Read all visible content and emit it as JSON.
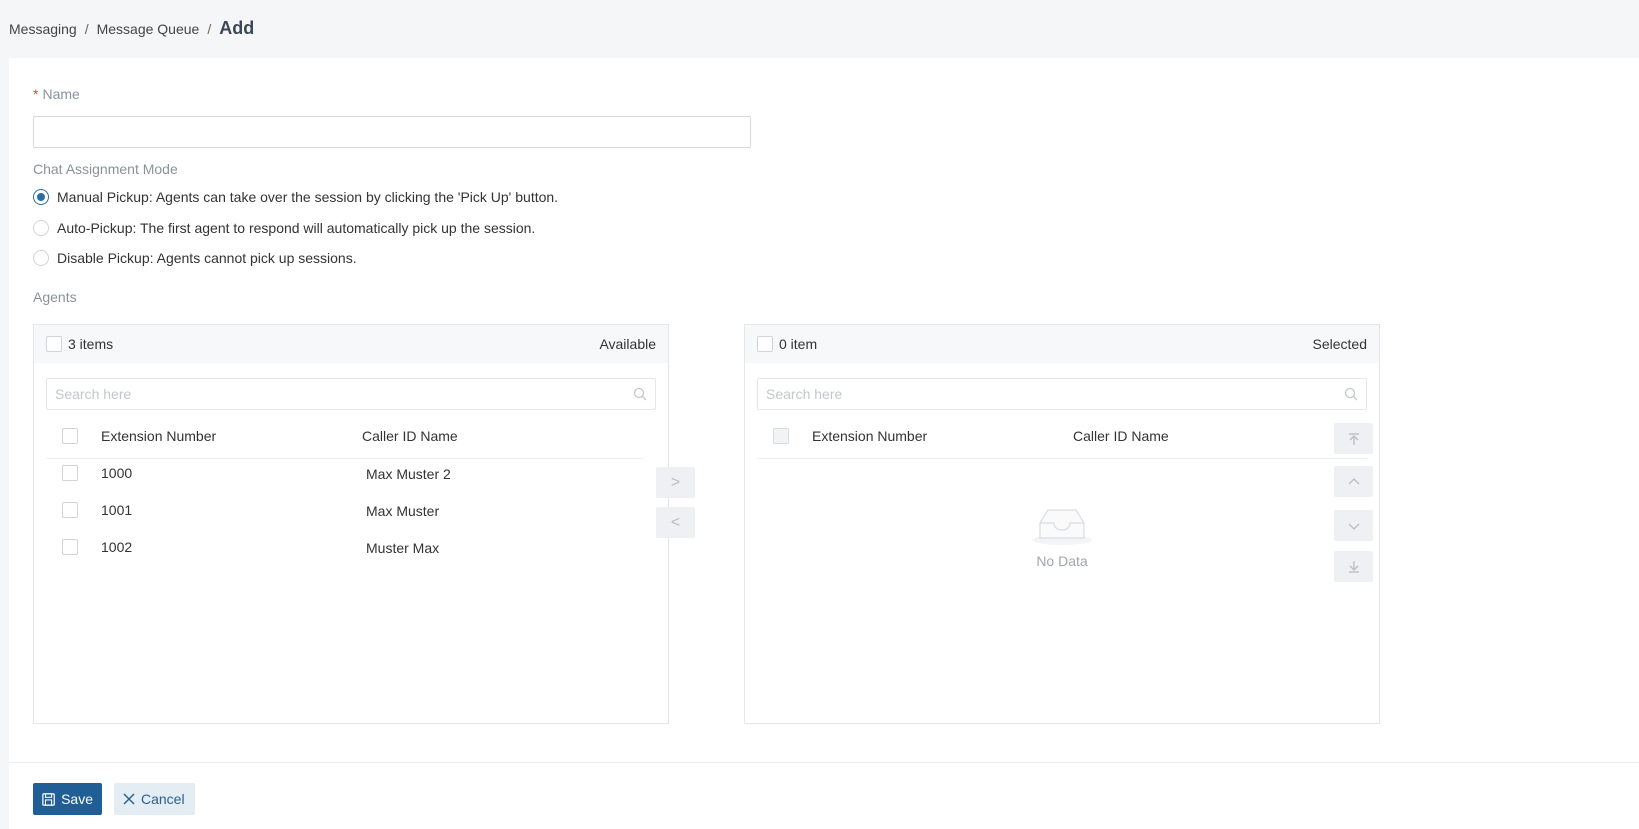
{
  "breadcrumb": {
    "item1": "Messaging",
    "item2": "Message Queue",
    "separator": "/",
    "current": "Add"
  },
  "form": {
    "name_required_mark": "*",
    "name_label": "Name",
    "name_value": "",
    "mode_label": "Chat Assignment Mode",
    "mode_options": [
      {
        "label": "Manual Pickup: Agents can take over the session by clicking the 'Pick Up' button.",
        "selected": true
      },
      {
        "label": "Auto-Pickup: The first agent to respond will automatically pick up the session.",
        "selected": false
      },
      {
        "label": "Disable Pickup: Agents cannot pick up sessions.",
        "selected": false
      }
    ],
    "agents_label": "Agents"
  },
  "transfer": {
    "left": {
      "count": "3 items",
      "title": "Available",
      "search_placeholder": "Search here",
      "columns": [
        "Extension Number",
        "Caller ID Name"
      ],
      "rows": [
        {
          "ext": "1000",
          "name": "Max Muster 2"
        },
        {
          "ext": "1001",
          "name": "Max Muster"
        },
        {
          "ext": "1002",
          "name": "Muster Max"
        }
      ]
    },
    "right": {
      "count": "0 item",
      "title": "Selected",
      "search_placeholder": "Search here",
      "columns": [
        "Extension Number",
        "Caller ID Name"
      ],
      "empty_text": "No Data"
    },
    "move_buttons": {
      "to_right": ">",
      "to_left": "<"
    },
    "order_icons": [
      "move-top-icon",
      "move-up-icon",
      "move-down-icon",
      "move-bottom-icon"
    ]
  },
  "actions": {
    "save_label": "Save",
    "cancel_label": "Cancel"
  },
  "colors": {
    "primary": "#1f5f96",
    "required": "#e0423d",
    "radio_checked": "#2a6fa3"
  }
}
